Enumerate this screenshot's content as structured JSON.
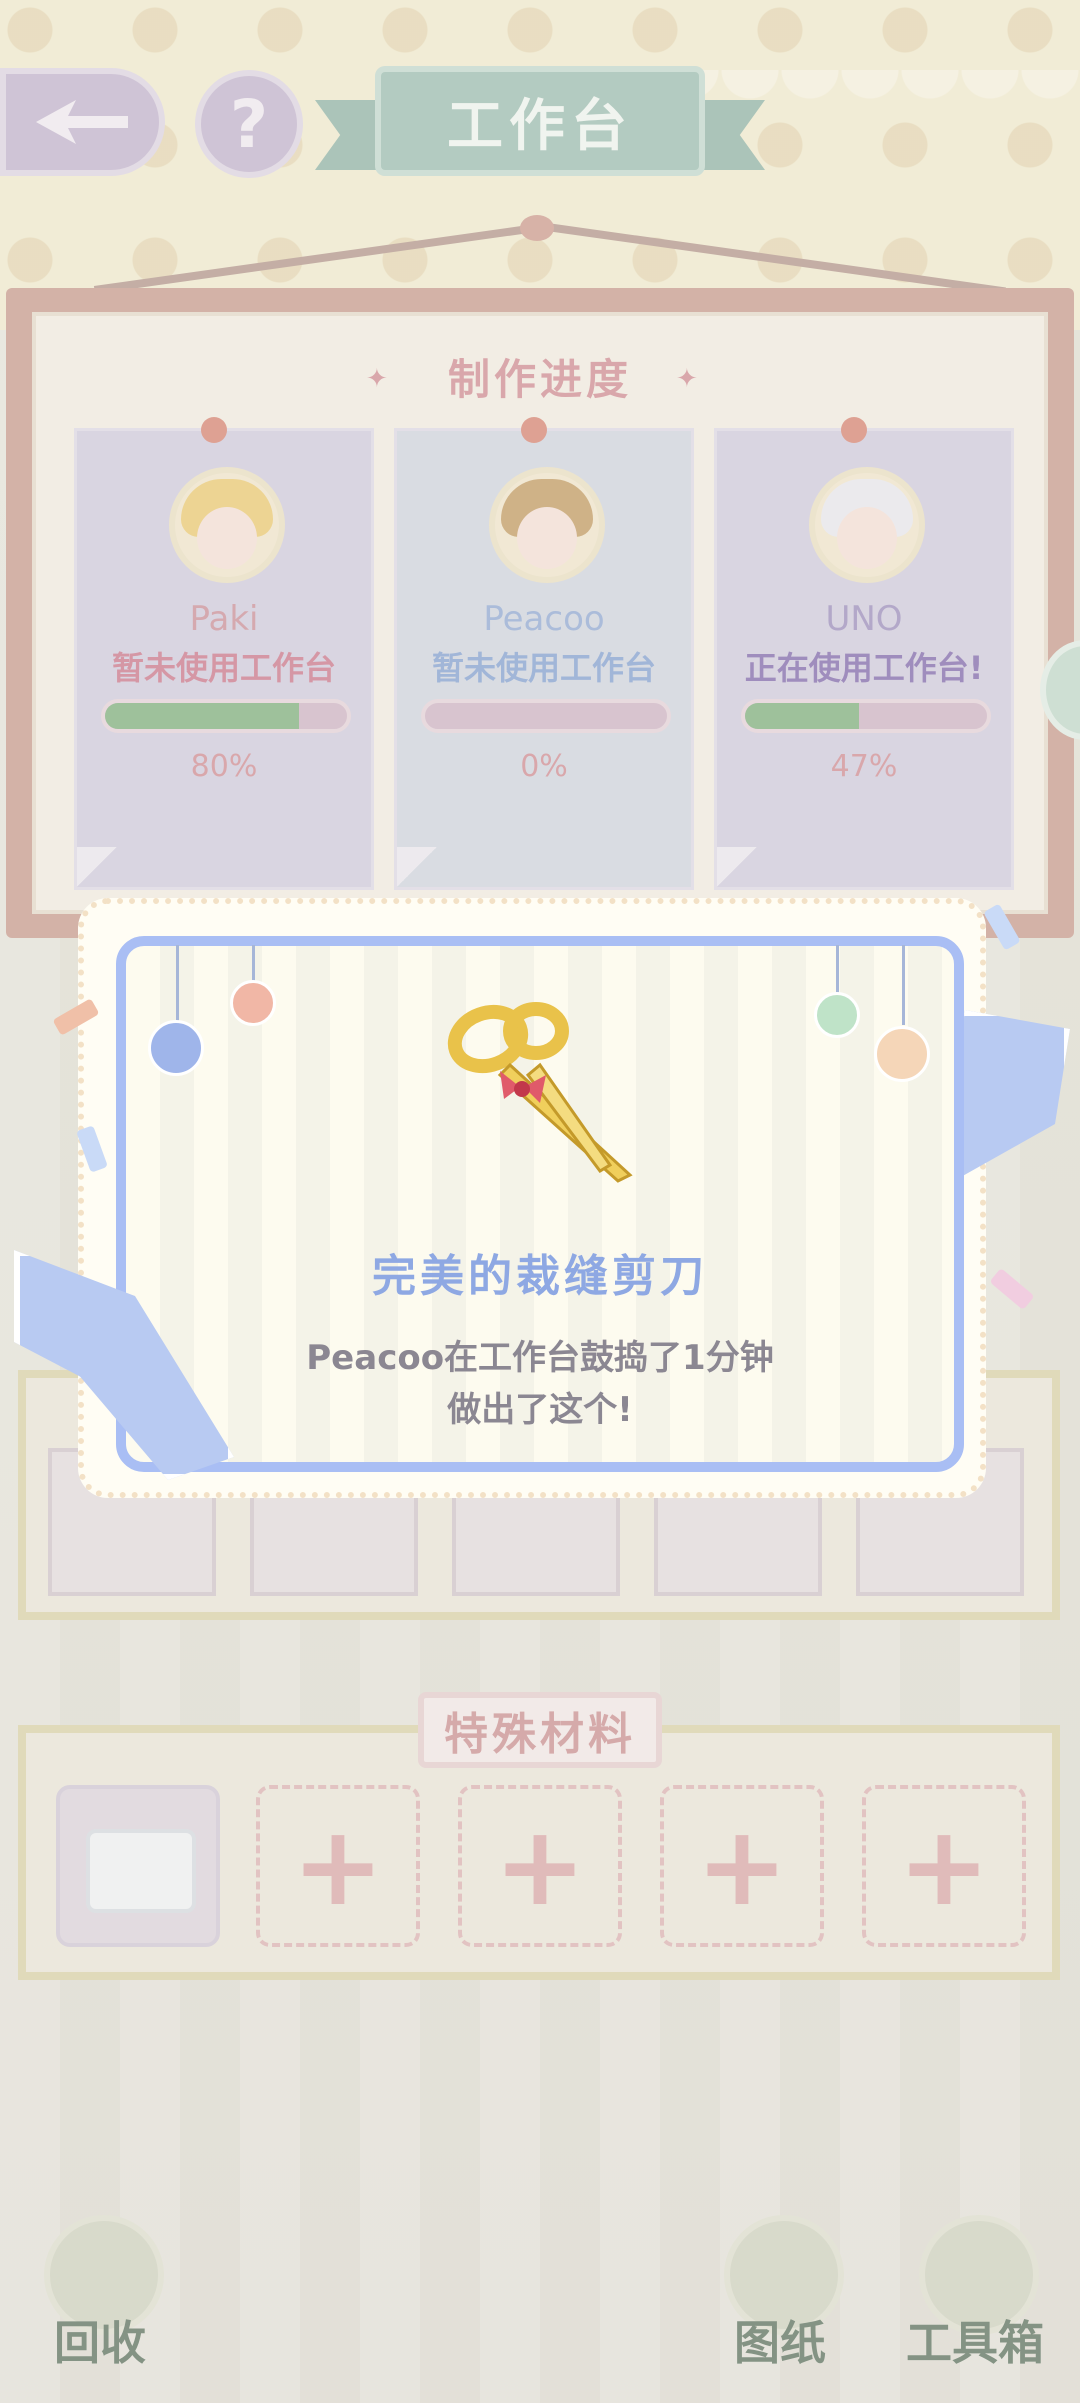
{
  "header": {
    "title": "工作台",
    "help_glyph": "?"
  },
  "progress_board": {
    "title": "制作进度",
    "cards": [
      {
        "name": "Paki",
        "status": "暂未使用工作台",
        "progress": 0.8,
        "progress_text": "80%",
        "name_color": "#c27c8a",
        "status_color": "#c2607a",
        "hair_color": "#e9c25c"
      },
      {
        "name": "Peacoo",
        "status": "暂未使用工作台",
        "progress": 0.0,
        "progress_text": "0%",
        "name_color": "#7f9ccf",
        "status_color": "#6f91cc",
        "hair_color": "#b88b4a"
      },
      {
        "name": "UNO",
        "status": "正在使用工作台!",
        "progress": 0.47,
        "progress_text": "47%",
        "name_color": "#8b7bb4",
        "status_color": "#6b4fa0",
        "hair_color": "#e6e6ee"
      }
    ]
  },
  "special_materials": {
    "label": "特殊材料",
    "slots": [
      "lace-material",
      "empty",
      "empty",
      "empty",
      "empty"
    ]
  },
  "popup": {
    "item_name": "完美的裁缝剪刀",
    "line1": "Peacoo在工作台鼓捣了1分钟",
    "line2": "做出了这个!",
    "item_icon": "golden-scissors-with-bow-icon"
  },
  "bottom_nav": {
    "recycle": "回收",
    "blueprint": "图纸",
    "toolbox": "工具箱"
  },
  "colors": {
    "accent_blue": "#a9bef4",
    "progress_green": "#6aa46a",
    "title_pink": "#c97a84",
    "banner_green": "#8cb4a6"
  }
}
